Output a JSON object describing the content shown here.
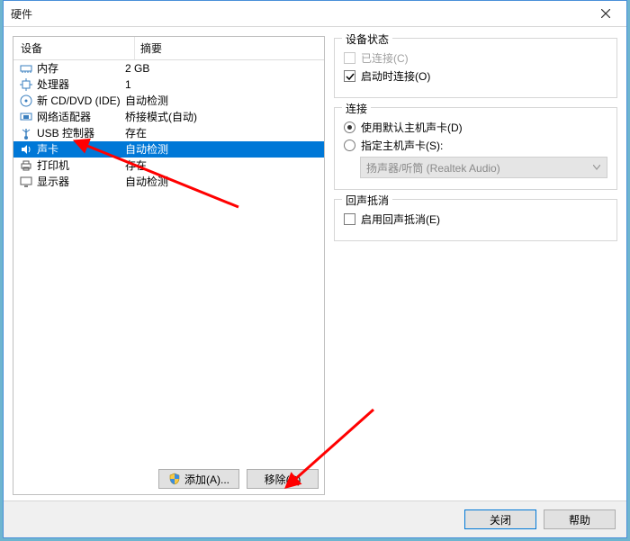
{
  "title": "硬件",
  "columns": {
    "device": "设备",
    "summary": "摘要"
  },
  "devices": [
    {
      "icon": "memory-icon",
      "name": "内存",
      "summary": "2 GB"
    },
    {
      "icon": "cpu-icon",
      "name": "处理器",
      "summary": "1"
    },
    {
      "icon": "disc-icon",
      "name": "新 CD/DVD (IDE)",
      "summary": "自动检测"
    },
    {
      "icon": "nic-icon",
      "name": "网络适配器",
      "summary": "桥接模式(自动)"
    },
    {
      "icon": "usb-icon",
      "name": "USB 控制器",
      "summary": "存在"
    },
    {
      "icon": "sound-icon",
      "name": "声卡",
      "summary": "自动检测",
      "selected": true
    },
    {
      "icon": "printer-icon",
      "name": "打印机",
      "summary": "存在"
    },
    {
      "icon": "display-icon",
      "name": "显示器",
      "summary": "自动检测"
    }
  ],
  "buttons": {
    "add": "添加(A)...",
    "remove": "移除(R)",
    "close": "关闭",
    "help": "帮助"
  },
  "status_group": {
    "legend": "设备状态",
    "connected": "已连接(C)",
    "connect_at_poweron": "启动时连接(O)"
  },
  "connection_group": {
    "legend": "连接",
    "use_default": "使用默认主机声卡(D)",
    "specify": "指定主机声卡(S):",
    "combo_value": "扬声器/听筒 (Realtek Audio)"
  },
  "echo_group": {
    "legend": "回声抵消",
    "enable_echo": "启用回声抵消(E)"
  }
}
